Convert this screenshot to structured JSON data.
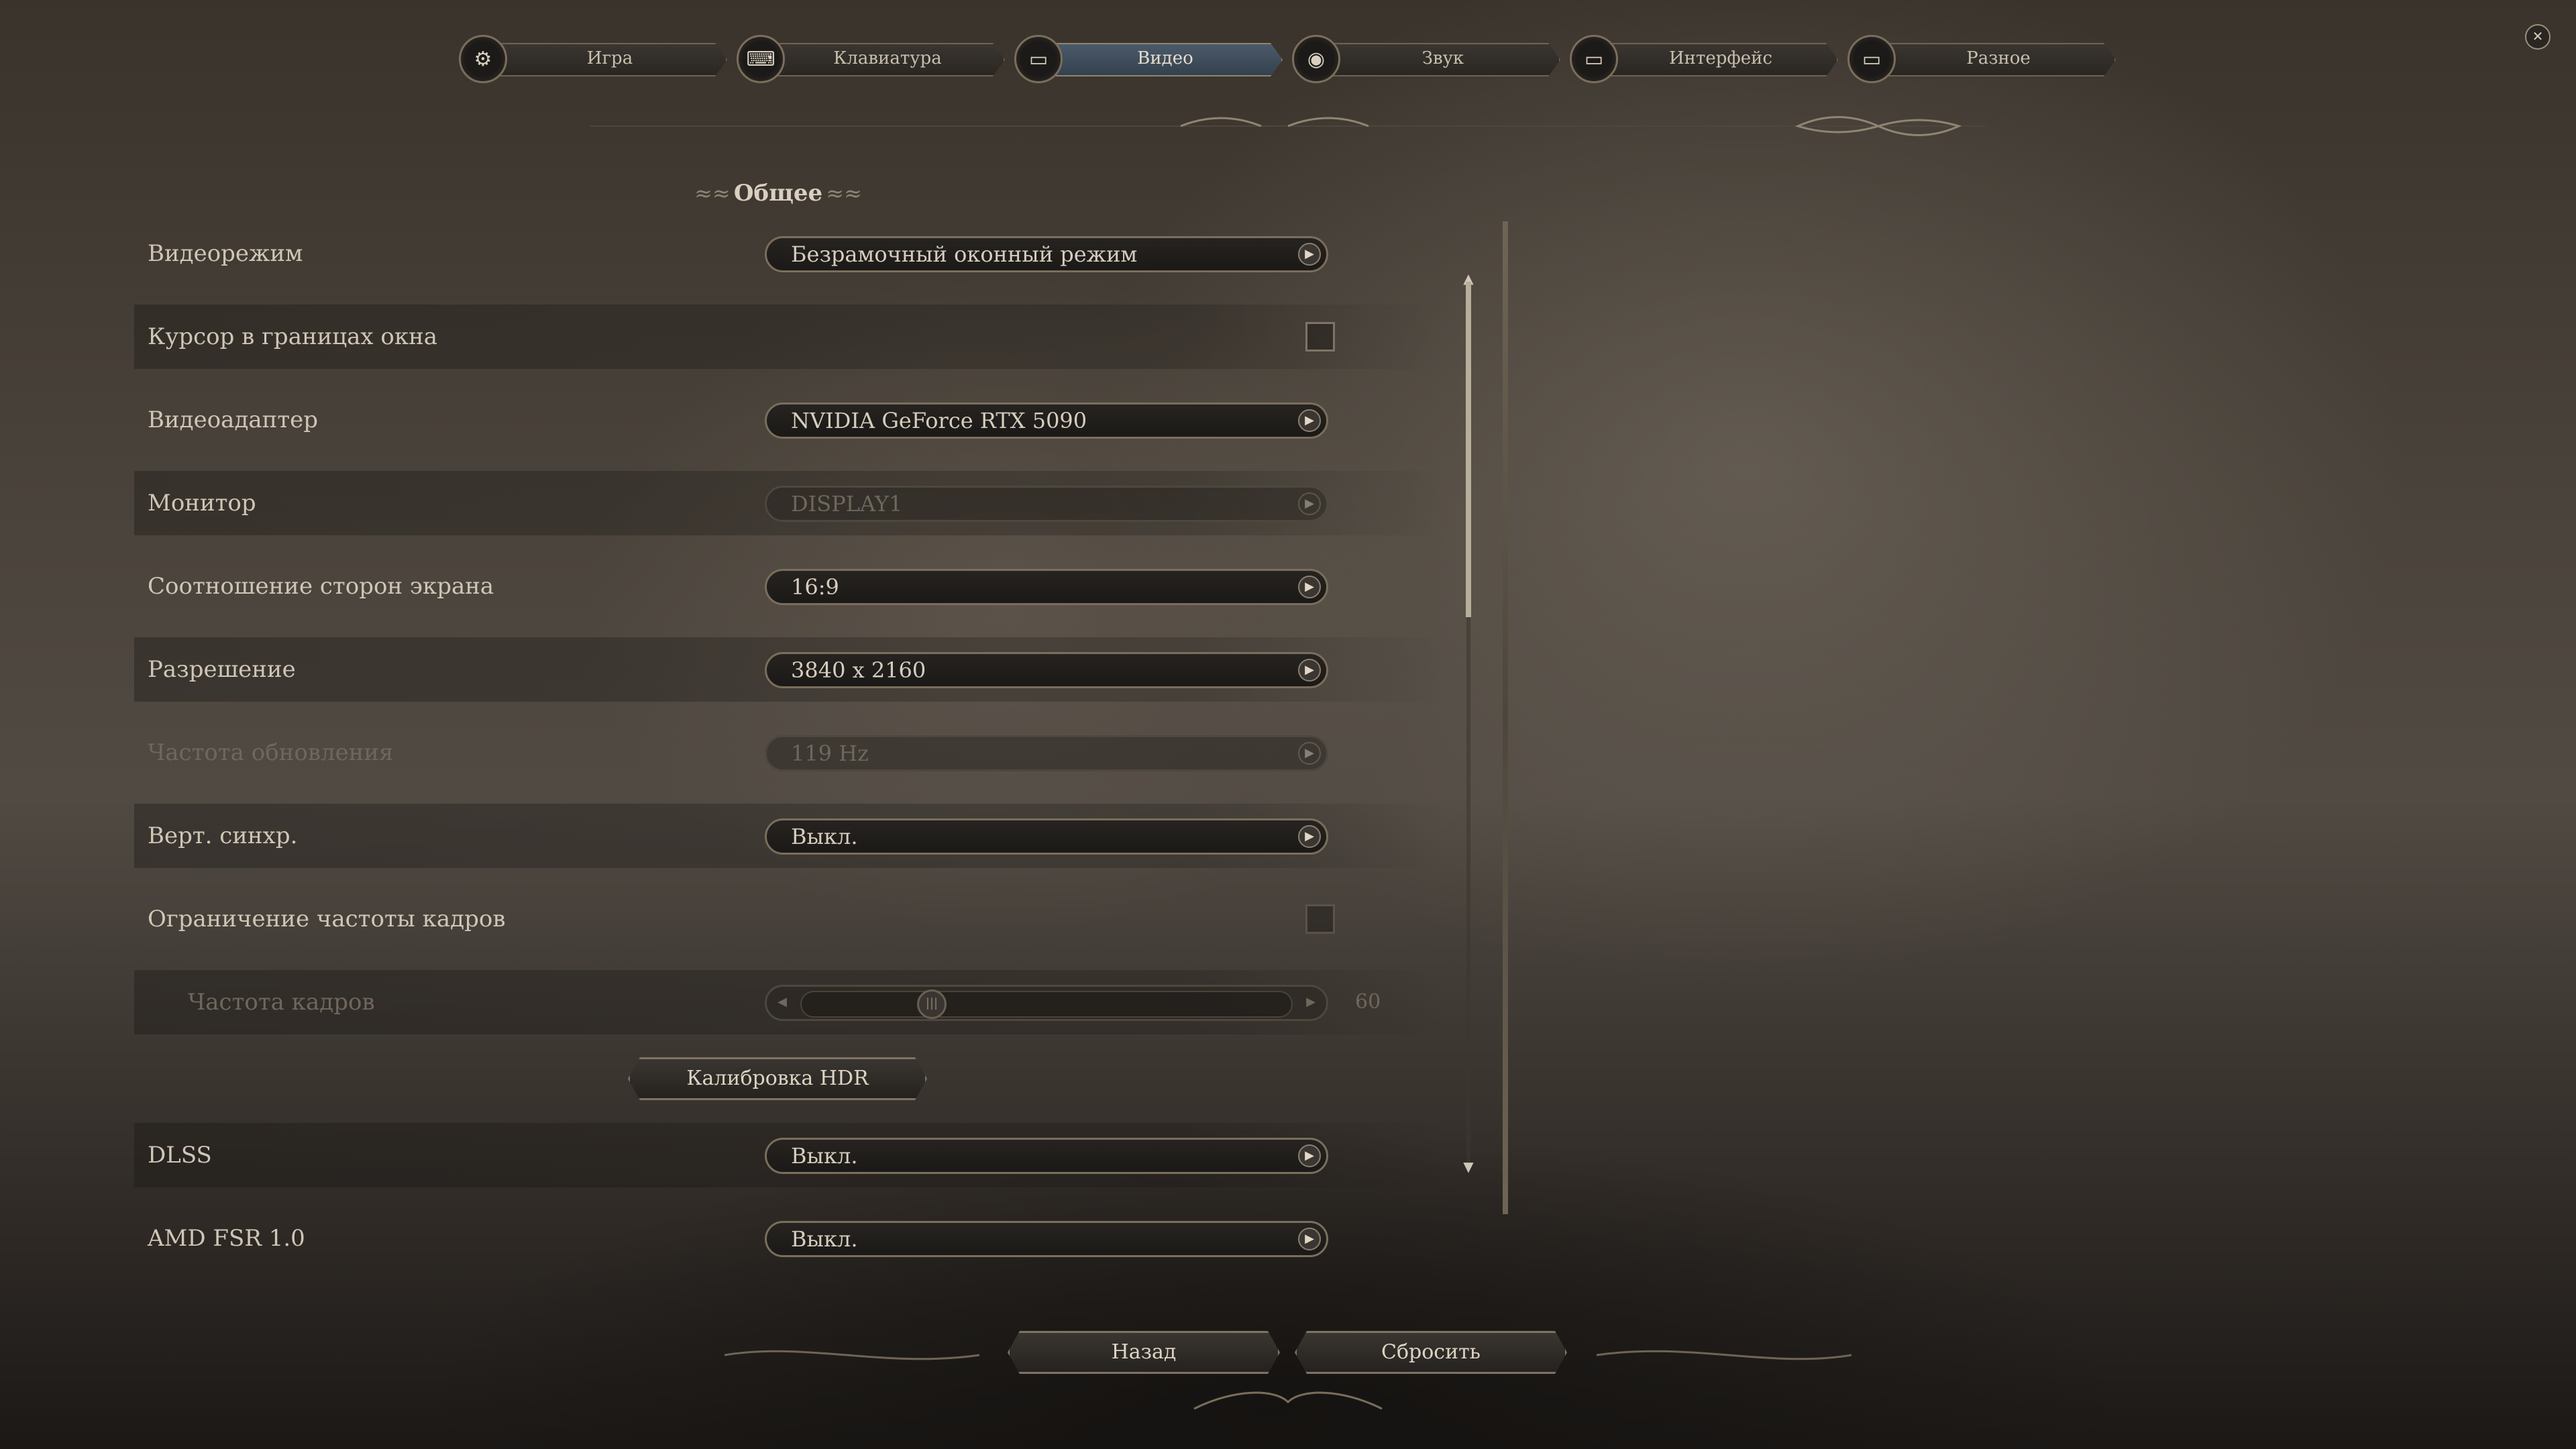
{
  "tabs": [
    {
      "label": "Игра",
      "icon": "gear-icon",
      "active": false
    },
    {
      "label": "Клавиатура",
      "icon": "keyboard-icon",
      "active": false
    },
    {
      "label": "Видео",
      "icon": "monitor-icon",
      "active": true
    },
    {
      "label": "Звук",
      "icon": "speaker-icon",
      "active": false
    },
    {
      "label": "Интерфейс",
      "icon": "monitor-icon",
      "active": false
    },
    {
      "label": "Разное",
      "icon": "monitor-icon",
      "active": false
    }
  ],
  "close_icon": "close-icon",
  "section": {
    "title": "Общее"
  },
  "settings": {
    "video_mode": {
      "label": "Видеорежим",
      "value": "Безрамочный оконный режим"
    },
    "cursor_confine": {
      "label": "Курсор в границах окна",
      "checked": false
    },
    "video_adapter": {
      "label": "Видеоадаптер",
      "value": "NVIDIA GeForce RTX 5090"
    },
    "monitor": {
      "label": "Монитор",
      "value": "DISPLAY1",
      "disabled": true
    },
    "aspect_ratio": {
      "label": "Соотношение сторон экрана",
      "value": "16:9"
    },
    "resolution": {
      "label": "Разрешение",
      "value": "3840 x 2160"
    },
    "refresh_rate": {
      "label": "Частота обновления",
      "value": "119 Hz",
      "disabled": true
    },
    "vsync": {
      "label": "Верт. синхр.",
      "value": "Выкл."
    },
    "frame_limit": {
      "label": "Ограничение частоты кадров",
      "checked": false
    },
    "frame_rate": {
      "label": "Частота кадров",
      "value": "60",
      "disabled": true,
      "level": 0.25
    },
    "hdr_calibration": {
      "label": "Калибровка HDR"
    },
    "dlss": {
      "label": "DLSS",
      "value": "Выкл."
    },
    "amd_fsr": {
      "label": "AMD FSR 1.0",
      "value": "Выкл."
    }
  },
  "footer": {
    "back": "Назад",
    "reset": "Сбросить"
  },
  "colors": {
    "accent_active_tab": "#4b5a6a",
    "border": "#7a6e5c",
    "text": "#c9c1b3",
    "disabled_text": "#6f675c"
  }
}
